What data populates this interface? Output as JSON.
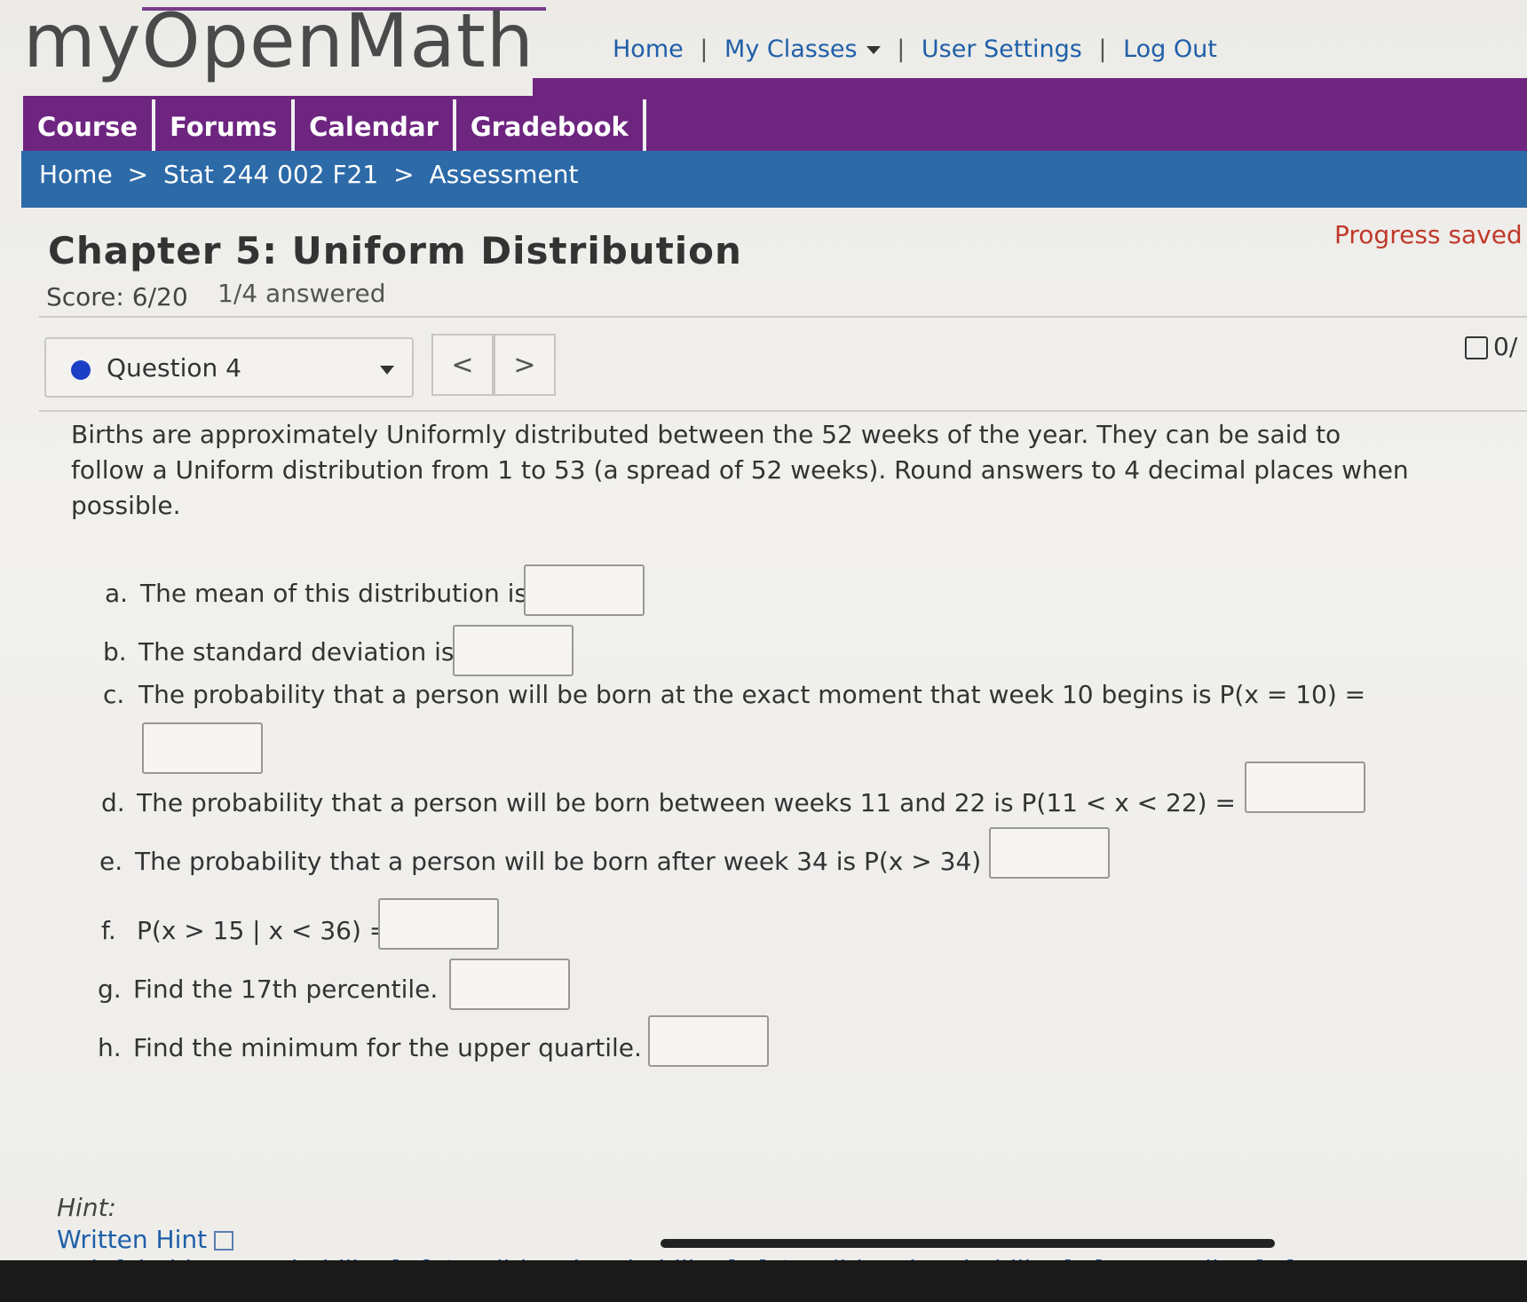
{
  "header": {
    "logo_text": "myOpenMath",
    "nav": {
      "home": "Home",
      "my_classes": "My Classes",
      "user_settings": "User Settings",
      "log_out": "Log Out",
      "sep": "|"
    }
  },
  "tabs": [
    "Course",
    "Forums",
    "Calendar",
    "Gradebook"
  ],
  "breadcrumb": {
    "home": "Home",
    "course": "Stat 244 002 F21",
    "current": "Assessment",
    "separator": ">"
  },
  "assessment": {
    "title": "Chapter 5: Uniform Distribution",
    "progress": "Progress saved",
    "score": "Score: 6/20",
    "answered": "1/4 answered",
    "question_select": "Question 4",
    "prev": "<",
    "next": ">",
    "points": "0/"
  },
  "question": {
    "prompt": "Births are approximately Uniformly distributed between the 52 weeks of the year. They can be said to follow a Uniform distribution from 1 to 53 (a spread of 52 weeks). Round answers to 4 decimal places when possible.",
    "parts": [
      {
        "label": "a.",
        "text": "The mean of this distribution is"
      },
      {
        "label": "b.",
        "text": "The standard deviation is"
      },
      {
        "label": "c.",
        "text": "The probability that a person will be born at the exact moment that week 10 begins is P(x = 10) ="
      },
      {
        "label": "d.",
        "text": "The probability that a person will be born between weeks 11 and 22 is P(11 < x < 22) ="
      },
      {
        "label": "e.",
        "text": "The probability that a person will be born after week 34 is P(x > 34) ="
      },
      {
        "label": "f.",
        "text": "P(x > 15 | x < 36) ="
      },
      {
        "label": "g.",
        "text": "Find the 17th percentile."
      },
      {
        "label": "h.",
        "text": "Find the minimum for the upper quartile."
      }
    ]
  },
  "hint": {
    "heading": "Hint:",
    "written_hint": "Written Hint",
    "videos": "Helpful Videos: Probability [+] Conditional Probability [+] Conditional Probability [+] Percentiles [+]"
  },
  "colors": {
    "purple": "#6e2580",
    "blue": "#2d6aa8",
    "link": "#1f5fa8",
    "progress_red": "#c0392b",
    "question_dot": "#1a3fc4"
  }
}
